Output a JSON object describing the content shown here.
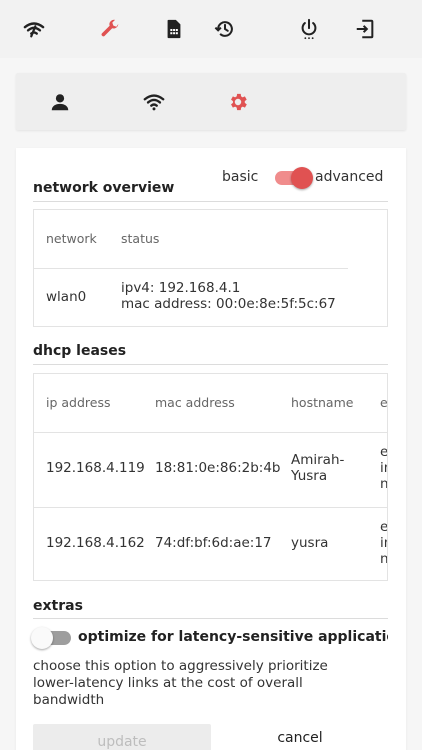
{
  "colors": {
    "accent": "#e05252",
    "icon": "#222222",
    "switch_on_track": "#f08c8c",
    "switch_off_track": "#9e9e9e"
  },
  "topbar": {
    "icons": [
      "wifi-signal-icon",
      "wrench-icon",
      "sim-card-icon",
      "history-icon",
      "power-icon",
      "logout-icon"
    ]
  },
  "tabs": {
    "icons": [
      "person-icon",
      "wifi-icon",
      "gear-icon"
    ],
    "active": "gear-icon"
  },
  "network_overview": {
    "title": "network overview",
    "mode_basic_label": "basic",
    "mode_advanced_label": "advanced",
    "mode": "advanced",
    "columns": [
      "network",
      "status"
    ],
    "rows": [
      {
        "network": "wlan0",
        "status_line1": "ipv4: 192.168.4.1",
        "status_line2": "mac address: 00:0e:8e:5f:5c:67"
      }
    ]
  },
  "dhcp_leases": {
    "title": "dhcp leases",
    "columns": [
      "ip address",
      "mac address",
      "hostname",
      "e"
    ],
    "rows": [
      {
        "ip": "192.168.4.119",
        "mac": "18:81:0e:86:2b:4b",
        "hostname_line1": "Amirah-",
        "hostname_line2": "Yusra",
        "extra": [
          "e",
          "in",
          "n"
        ]
      },
      {
        "ip": "192.168.4.162",
        "mac": "74:df:bf:6d:ae:17",
        "hostname_line1": "yusra",
        "hostname_line2": "",
        "extra": [
          "e",
          "in",
          "n"
        ]
      }
    ]
  },
  "extras": {
    "title": "extras",
    "option_label": "optimize for latency-sensitive applicatio...",
    "option_enabled": false,
    "description": "choose this option to aggressively prioritize lower-latency links at the cost of overall bandwidth"
  },
  "actions": {
    "update_label": "update",
    "cancel_label": "cancel"
  }
}
